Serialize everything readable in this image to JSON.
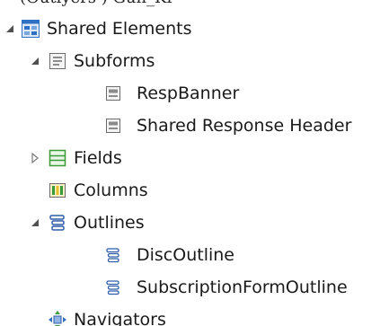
{
  "top_cut_text": "(Outlyers ) Gun_Kr",
  "tree": {
    "shared_elements": {
      "label": "Shared Elements",
      "icon": "shared-elements-icon",
      "expanded": true
    },
    "subforms": {
      "label": "Subforms",
      "icon": "subform-folder-icon",
      "expanded": true
    },
    "resp_banner": {
      "label": "RespBanner",
      "icon": "subform-icon"
    },
    "shared_response_header": {
      "label": "Shared Response Header",
      "icon": "subform-icon"
    },
    "fields": {
      "label": "Fields",
      "icon": "fields-icon",
      "expanded": false
    },
    "columns": {
      "label": "Columns",
      "icon": "columns-icon"
    },
    "outlines": {
      "label": "Outlines",
      "icon": "outline-folder-icon",
      "expanded": true
    },
    "disc_outline": {
      "label": "DiscOutline",
      "icon": "outline-icon"
    },
    "subscription_form_outline": {
      "label": "SubscriptionFormOutline",
      "icon": "outline-icon"
    },
    "navigators": {
      "label": "Navigators",
      "icon": "navigator-icon"
    }
  },
  "colors": {
    "twisty": "#505050",
    "shared_blue": "#2f6fc4",
    "fields_green": "#3a9a3a",
    "columns_yellow": "#e6c12e",
    "outline_blue": "#2f5da8"
  }
}
